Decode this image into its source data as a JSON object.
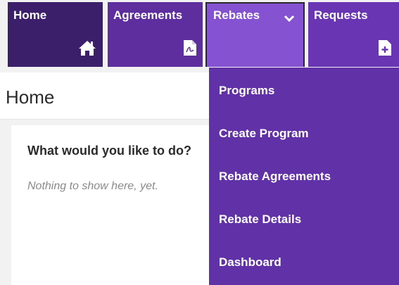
{
  "nav": {
    "home_label": "Home",
    "agreements_label": "Agreements",
    "rebates_label": "Rebates",
    "requests_label": "Requests"
  },
  "icons": {
    "home": "house-icon",
    "agreements": "pdf-document-icon",
    "rebates": "chevron-down-icon",
    "requests": "add-document-icon"
  },
  "page": {
    "title": "Home"
  },
  "card": {
    "heading": "What would you like to do?",
    "empty_text": "Nothing to show here, yet."
  },
  "rebates_menu": {
    "items": [
      "Programs",
      "Create Program",
      "Rebate Agreements",
      "Rebate Details",
      "Dashboard"
    ]
  },
  "colors": {
    "home_tile": "#3c1f6b",
    "agreements_tile": "#5e2d9e",
    "rebates_tile_active": "#8553d2",
    "requests_tile": "#6a35b3",
    "dropdown_bg": "#6131a8"
  }
}
